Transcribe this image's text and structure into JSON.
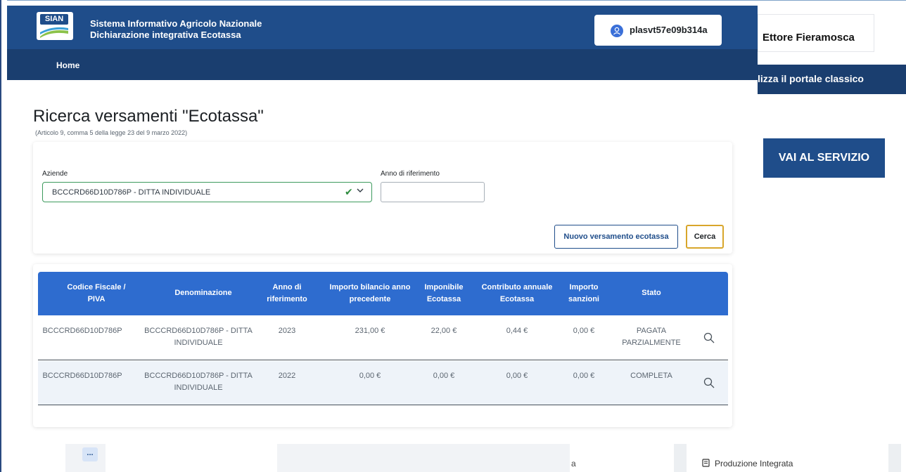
{
  "header": {
    "logo_text": "SIAN",
    "title_line1": "Sistema Informativo Agricolo Nazionale",
    "title_line2": "Dichiarazione integrativa Ecotassa",
    "user_code": "plasvt57e09b314a",
    "nav_home": "Home",
    "colors": {
      "primary": "#1f4d8a",
      "nav": "#1a3e6f",
      "accent": "#2e6ccf"
    }
  },
  "overlay": {
    "user_name": "Ettore Fieramosca",
    "classic_portal_text": "lizza il portale classico",
    "service_button": "VAI AL SERVIZIO"
  },
  "page": {
    "title": "Ricerca versamenti \"Ecotassa\"",
    "subtitle": "(Articolo 9, comma 5 della legge 23 del 9 marzo 2022)"
  },
  "filters": {
    "aziende_label": "Aziende",
    "aziende_value": "BCCCRD66D10D786P - DITTA INDIVIDUALE",
    "anno_label": "Anno di riferimento",
    "anno_value": "",
    "new_button": "Nuovo versamento ecotassa",
    "search_button": "Cerca"
  },
  "table": {
    "headers": [
      [
        "Codice Fiscale /",
        "PIVA"
      ],
      [
        "Denominazione"
      ],
      [
        "Anno di",
        "riferimento"
      ],
      [
        "Importo bilancio anno",
        "precedente"
      ],
      [
        "Imponibile",
        "Ecotassa"
      ],
      [
        "Contributo annuale",
        "Ecotassa"
      ],
      [
        "Importo",
        "sanzioni"
      ],
      [
        "Stato"
      ]
    ],
    "rows": [
      {
        "codice": "BCCCRD66D10D786P",
        "denominazione_1": "BCCCRD66D10D786P - DITTA",
        "denominazione_2": "INDIVIDUALE",
        "anno": "2023",
        "bilancio": "231,00 €",
        "imponibile": "22,00 €",
        "contributo": "0,44 €",
        "sanzioni": "0,00 €",
        "stato_1": "PAGATA",
        "stato_2": "PARZIALMENTE"
      },
      {
        "codice": "BCCCRD66D10D786P",
        "denominazione_1": "BCCCRD66D10D786P - DITTA",
        "denominazione_2": "INDIVIDUALE",
        "anno": "2022",
        "bilancio": "0,00 €",
        "imponibile": "0,00 €",
        "contributo": "0,00 €",
        "sanzioni": "0,00 €",
        "stato_1": "COMPLETA",
        "stato_2": ""
      }
    ]
  },
  "bottom": {
    "dots": "...",
    "fragment_a": "a",
    "produzione": "Produzione Integrata"
  }
}
